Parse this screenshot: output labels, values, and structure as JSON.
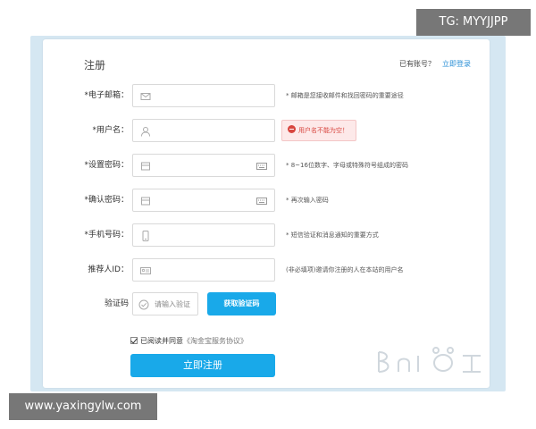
{
  "header": {
    "title": "注册",
    "has_account": "已有账号？",
    "login_link": "立即登录"
  },
  "fields": [
    {
      "label": "*电子邮箱：",
      "icon": "mail-icon",
      "hint": "* 邮箱是您接收邮件和找回密码的重要途径"
    },
    {
      "label": "*用户名：",
      "icon": "user-icon",
      "error": "用户名不能为空！"
    },
    {
      "label": "*设置密码：",
      "icon": "lock-icon",
      "right_icon": "keyboard-icon",
      "hint": "* 8~16位数字、字母或特殊符号组成的密码"
    },
    {
      "label": "*确认密码：",
      "icon": "lock-icon",
      "right_icon": "keyboard-icon",
      "hint": "* 再次输入密码"
    },
    {
      "label": "*手机号码：",
      "icon": "phone-icon",
      "hint": "* 短信验证和消息通知的重要方式"
    },
    {
      "label": "推荐人ID：",
      "icon": "id-card-icon",
      "hint": "(非必填项)邀请你注册的人在本站的用户名"
    }
  ],
  "captcha": {
    "label": "验证码",
    "placeholder": "请输入验证",
    "button": "获取验证码"
  },
  "agreement": {
    "checked": true,
    "text": "已阅读并同意",
    "protocol": "《淘金宝服务协议》"
  },
  "submit_label": "立即注册",
  "overlays": {
    "tg": "TG: MYYJJPP",
    "site": "www.yaxingylw.com"
  },
  "colors": {
    "accent": "#19a9e9",
    "error": "#d8463f",
    "link": "#2a8fd6",
    "frame": "#d5e7f2"
  }
}
